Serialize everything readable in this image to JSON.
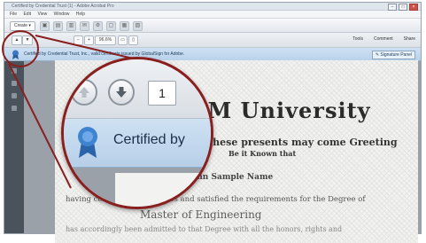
{
  "window": {
    "title": "Certified by Credential Trust (1) - Adobe Acrobat Pro",
    "menu": [
      "File",
      "Edit",
      "View",
      "Window",
      "Help"
    ]
  },
  "toolbar": {
    "create_label": "Create",
    "page_number": "1",
    "zoom_value": "96.6%",
    "tabs": [
      "Tools",
      "Comment",
      "Share"
    ]
  },
  "certbar": {
    "message": "Certified by Credential Trust, Inc., valid certificate issued by GlobalSign for Adobe.",
    "signature_panel_label": "Signature Panel"
  },
  "document": {
    "university": "&M University",
    "line1": "These presents may come Greeting",
    "line2": "Be it Known that",
    "name": "John Sample Name",
    "line4": "having completed the studies and satisfied the requirements for the Degree of",
    "degree": "Master of Engineering",
    "line6": "has accordingly been admitted to that Degree with all the honors, rights and"
  },
  "magnifier": {
    "page_number": "1",
    "cert_text": "Certified by"
  },
  "colors": {
    "callout_red": "#8a1f1f",
    "cert_blue": "#cfe1f3"
  }
}
